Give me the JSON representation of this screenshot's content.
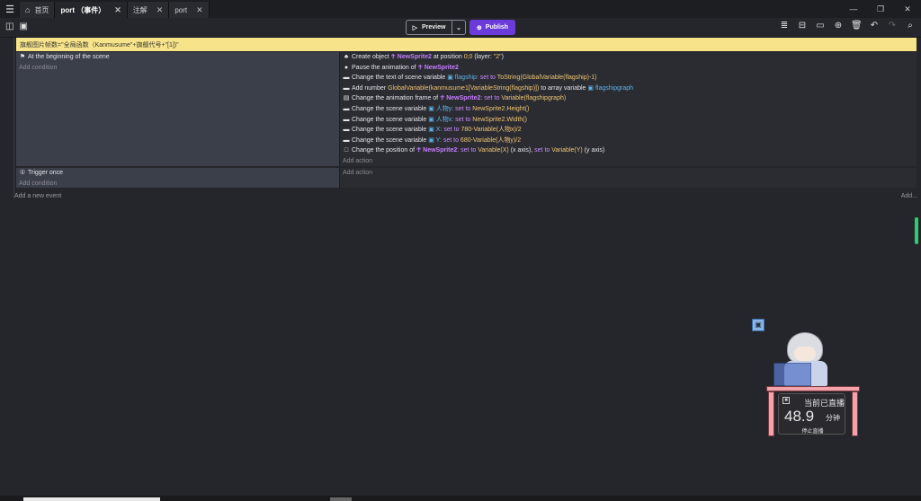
{
  "tabs": [
    {
      "label": "首页",
      "icon": "home-icon",
      "closable": false,
      "active": false
    },
    {
      "label": "port （事件）",
      "closable": true,
      "active": true
    },
    {
      "label": "注解",
      "closable": true,
      "active": false
    },
    {
      "label": "port",
      "closable": true,
      "active": false
    }
  ],
  "toolbar": {
    "preview_label": "Preview",
    "publish_label": "Publish",
    "accent": "#6b3bd9"
  },
  "comment": {
    "text": "旗舰图片帧数=\"全局函数（Kanmusume\"+旗舰代号+\"[1])\"",
    "color": "#f7e48a"
  },
  "event1": {
    "condition": "At the beginning of the scene",
    "add_condition": "Add condition",
    "actions": [
      {
        "parts": [
          "Create object ",
          {
            "obj": "NewSprite2"
          },
          " at position ",
          {
            "val": "0;0"
          },
          " (layer: ",
          {
            "val": "\"2\""
          },
          ")"
        ]
      },
      {
        "parts": [
          "Pause the animation of ",
          {
            "obj": "NewSprite2"
          }
        ]
      },
      {
        "parts": [
          "Change the text of scene variable ",
          {
            "var": "flagship"
          },
          {
            "kw": ": set to "
          },
          {
            "val": "ToString(GlobalVariable(flagship)-1)"
          }
        ]
      },
      {
        "parts": [
          "Add number ",
          {
            "val": "GlobalVariable(kanmusume1[VariableString(flagship)])"
          },
          " to array variable ",
          {
            "var": "flagshipgraph"
          }
        ]
      },
      {
        "parts": [
          "Change the animation frame of ",
          {
            "obj": "NewSprite2"
          },
          {
            "kw": ": set to "
          },
          {
            "val": "Variable(flagshipgraph)"
          }
        ]
      },
      {
        "parts": [
          "Change the scene variable ",
          {
            "var": "人物y"
          },
          {
            "kw": ": set to "
          },
          {
            "val": "NewSprite2.Height()"
          }
        ]
      },
      {
        "parts": [
          "Change the scene variable ",
          {
            "var": "人物x"
          },
          {
            "kw": ": set to "
          },
          {
            "val": "NewSprite2.Width()"
          }
        ]
      },
      {
        "parts": [
          "Change the scene variable ",
          {
            "var": "X"
          },
          {
            "kw": ": set to "
          },
          {
            "val": "780-Variable(人物x)/2"
          }
        ]
      },
      {
        "parts": [
          "Change the scene variable ",
          {
            "var": "Y"
          },
          {
            "kw": ": set to "
          },
          {
            "val": "680-Variable(人物y)/2"
          }
        ]
      },
      {
        "parts": [
          "Change the position of ",
          {
            "obj": "NewSprite2"
          },
          {
            "kw": ": set to "
          },
          {
            "val": "Variable(X)"
          },
          " (x axis), ",
          {
            "kw": "set to "
          },
          {
            "val": "Variable(Y)"
          },
          " (y axis)"
        ]
      }
    ],
    "add_action": "Add action"
  },
  "event2": {
    "condition": "Trigger once",
    "add_condition": "Add condition",
    "add_action": "Add action"
  },
  "add_event": "Add a new event",
  "add_more": "Add...",
  "live_widget": {
    "status": "当前已直播",
    "value": "48.9",
    "unit": "分钟",
    "stop": "停止直播"
  }
}
